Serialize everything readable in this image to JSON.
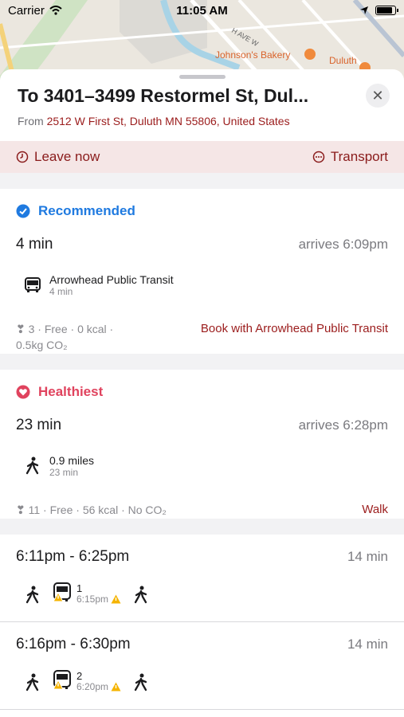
{
  "status_bar": {
    "carrier": "Carrier",
    "time": "11:05 AM"
  },
  "map": {
    "label_bakery": "Johnson's Bakery",
    "label_duluth": "Duluth",
    "street_labels": [
      "H AVE W",
      "W"
    ]
  },
  "header": {
    "title": "To 3401–3499 Restormel St, Dul...",
    "from_prefix": "From",
    "from_address": "2512 W First St, Duluth MN 55806, United States"
  },
  "options_bar": {
    "leave_label": "Leave now",
    "mode_label": "Transport"
  },
  "recommended": {
    "badge": "Recommended",
    "duration": "4 min",
    "arrives": "arrives 6:09pm",
    "leg_title": "Arrowhead Public Transit",
    "leg_sub": "4 min",
    "stats_line1": "❣ 3 · Free · 0 kcal ·",
    "stats_line2": "0.5kg CO₂",
    "action": "Book with Arrowhead Public Transit"
  },
  "healthiest": {
    "badge": "Healthiest",
    "duration": "23 min",
    "arrives": "arrives 6:28pm",
    "leg_title": "0.9 miles",
    "leg_sub": "23 min",
    "stats": "❣ 11 · Free · 56 kcal · No CO₂",
    "action": "Walk"
  },
  "trips": [
    {
      "times": "6:11pm - 6:25pm",
      "duration": "14 min",
      "route": "1",
      "depart": "6:15pm"
    },
    {
      "times": "6:16pm - 6:30pm",
      "duration": "14 min",
      "route": "2",
      "depart": "6:20pm"
    }
  ],
  "colors": {
    "accent_red": "#9b1c1c",
    "recommended_blue": "#1f7ae0",
    "healthiest_pink": "#e0435e",
    "warning": "#f5b400"
  }
}
